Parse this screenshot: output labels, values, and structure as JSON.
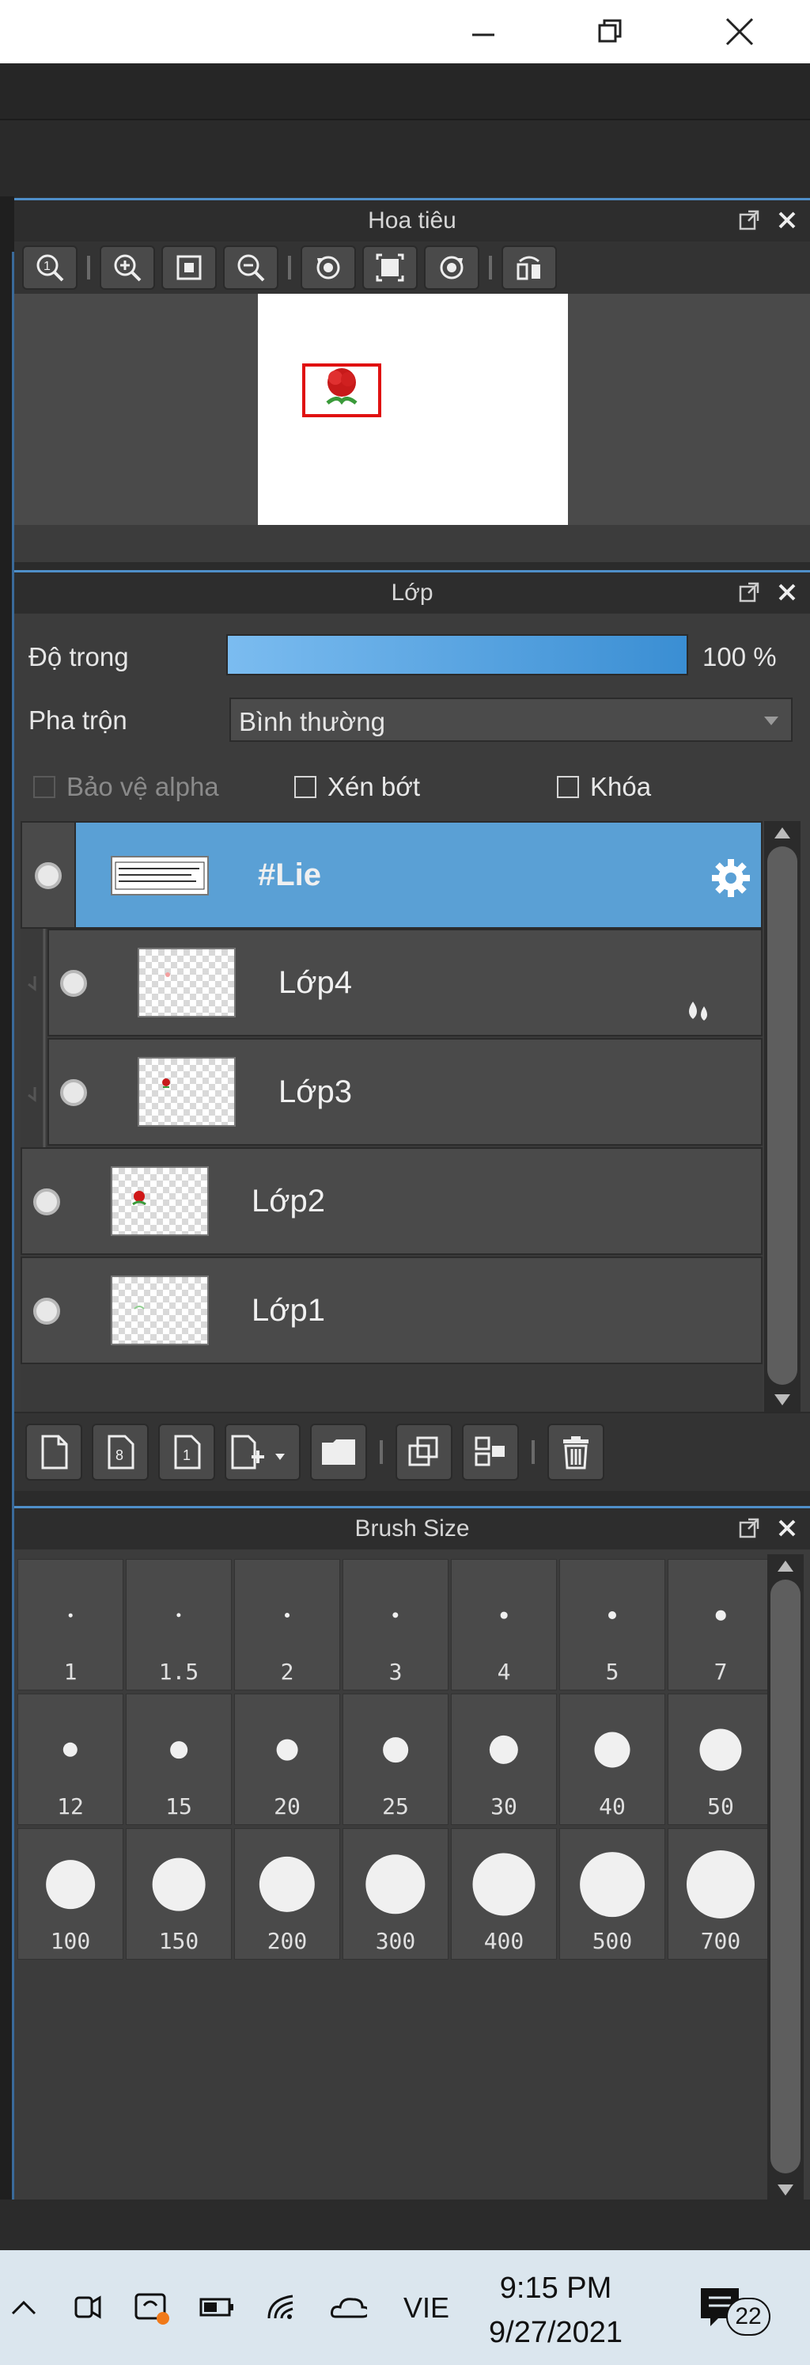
{
  "window": {
    "minimize_label": "minimize",
    "maximize_label": "restore",
    "close_label": "close"
  },
  "navigator": {
    "title": "Hoa tiêu"
  },
  "layers": {
    "title": "Lớp",
    "opacity_label": "Độ trong",
    "opacity_value": "100 %",
    "opacity_fraction": 1.0,
    "blend_label": "Pha trộn",
    "blend_value": "Bình thường",
    "protect_alpha": "Bảo vệ alpha",
    "clipping": "Xén bớt",
    "lock": "Khóa",
    "items": [
      {
        "name": "#Lie",
        "selected": true
      },
      {
        "name": "Lớp4",
        "selected": false
      },
      {
        "name": "Lớp3",
        "selected": false
      },
      {
        "name": "Lớp2",
        "selected": false
      },
      {
        "name": "Lớp1",
        "selected": false
      }
    ]
  },
  "brush": {
    "title": "Brush Size",
    "sizes": [
      "1",
      "1.5",
      "2",
      "3",
      "4",
      "5",
      "7",
      "12",
      "15",
      "20",
      "25",
      "30",
      "40",
      "50",
      "100",
      "150",
      "200",
      "300",
      "400",
      "500",
      "700"
    ]
  },
  "taskbar": {
    "language": "VIE",
    "time": "9:15 PM",
    "date": "9/27/2021",
    "notification_count": "22"
  },
  "colors": {
    "accent": "#4f8fc9",
    "selected_layer": "#5aa0d5",
    "panel_bg": "#3c3c3c"
  }
}
